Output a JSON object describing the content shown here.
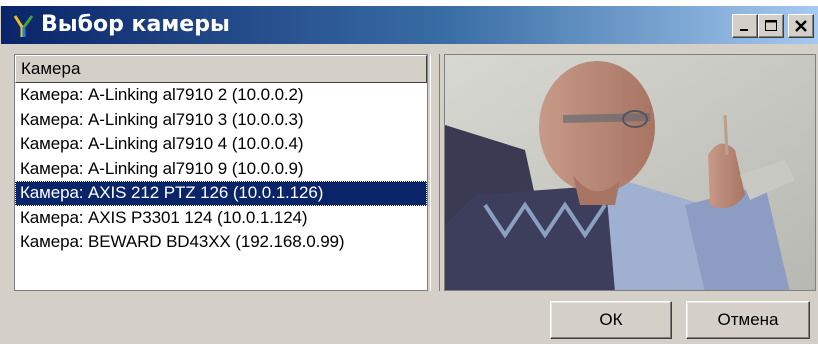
{
  "window": {
    "title": "Выбор камеры",
    "buttons": {
      "minimize": "minimize",
      "maximize": "maximize",
      "close": "close"
    }
  },
  "list": {
    "column_header": "Камера",
    "items": [
      {
        "label": "Камера: A-Linking al7910 2 (10.0.0.2)",
        "selected": false
      },
      {
        "label": "Камера: A-Linking al7910 3 (10.0.0.3)",
        "selected": false
      },
      {
        "label": "Камера: A-Linking al7910 4 (10.0.0.4)",
        "selected": false
      },
      {
        "label": "Камера: A-Linking al7910 9 (10.0.0.9)",
        "selected": false
      },
      {
        "label": "Камера: AXIS 212 PTZ 126 (10.0.1.126)",
        "selected": true
      },
      {
        "label": "Камера: AXIS P3301 124 (10.0.1.124)",
        "selected": false
      },
      {
        "label": "Камера: BEWARD BD43XX (192.168.0.99)",
        "selected": false
      }
    ]
  },
  "footer": {
    "ok_label": "ОК",
    "cancel_label": "Отмена"
  },
  "colors": {
    "selection": "#0a246a",
    "face": "#d4d0c8"
  }
}
